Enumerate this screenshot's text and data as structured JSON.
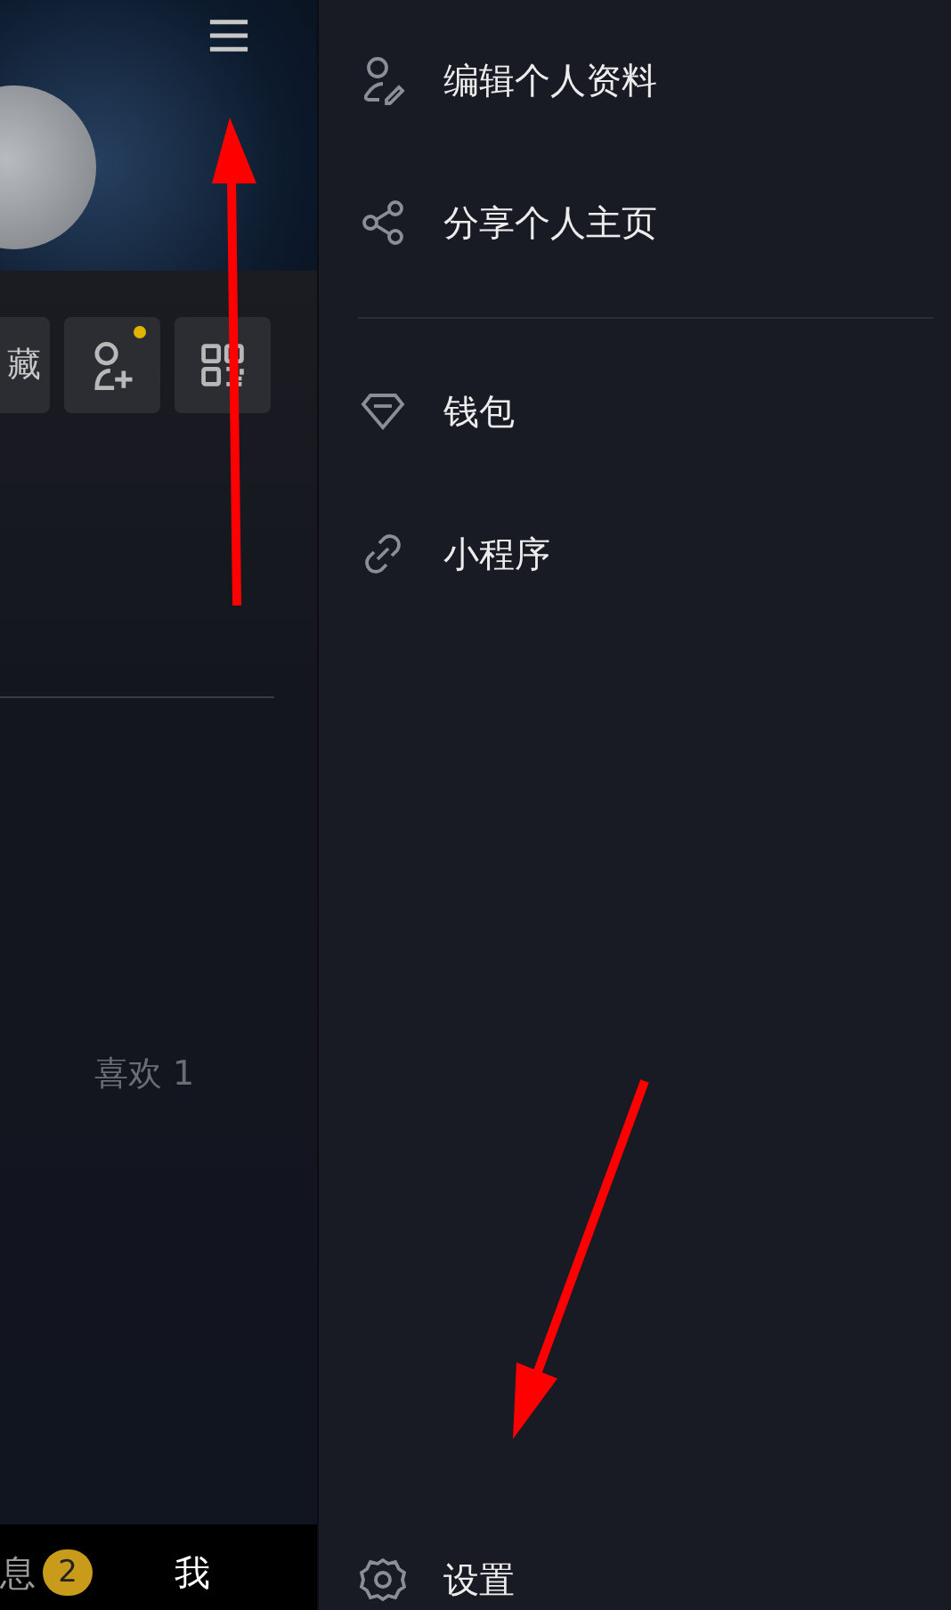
{
  "profile": {
    "action_buttons": [
      {
        "kind": "text",
        "label": "藏",
        "notification": false
      },
      {
        "kind": "add-person",
        "notification": true
      },
      {
        "kind": "grid",
        "notification": false
      }
    ],
    "likes_label": "喜欢 1"
  },
  "tab_bar": [
    {
      "label": "息",
      "badge": "2",
      "selected": false
    },
    {
      "label": "我",
      "selected": true
    }
  ],
  "drawer": {
    "sections": [
      [
        {
          "kind": "edit-person",
          "label": "编辑个人资料"
        },
        {
          "kind": "share",
          "label": "分享个人主页"
        }
      ],
      [
        {
          "kind": "diamond",
          "label": "钱包"
        },
        {
          "kind": "link",
          "label": "小程序"
        }
      ]
    ],
    "footer": {
      "kind": "gear",
      "label": "设置"
    }
  }
}
